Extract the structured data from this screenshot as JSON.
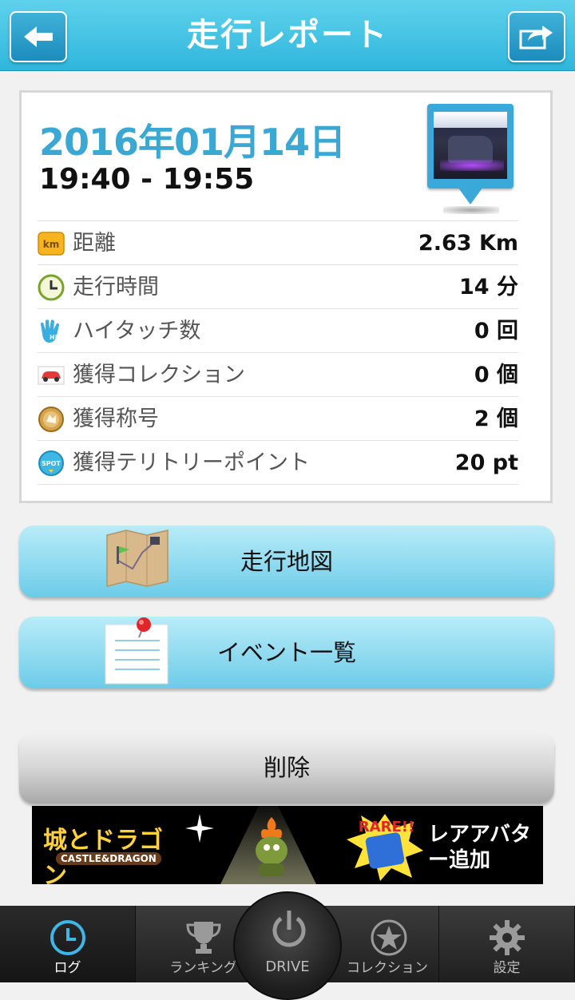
{
  "header": {
    "title": "走行レポート",
    "back_icon": "arrow-left-icon",
    "share_icon": "share-icon"
  },
  "report": {
    "date": "2016年01月14日",
    "time_range": "19:40 - 19:55",
    "stats": [
      {
        "icon": "km-icon",
        "label": "距離",
        "value": "2.63 Km"
      },
      {
        "icon": "clock-icon",
        "label": "走行時間",
        "value": "14 分"
      },
      {
        "icon": "high-five-icon",
        "label": "ハイタッチ数",
        "value": "0 回"
      },
      {
        "icon": "car-icon",
        "label": "獲得コレクション",
        "value": "0 個"
      },
      {
        "icon": "medal-icon",
        "label": "獲得称号",
        "value": "2 個"
      },
      {
        "icon": "spot-icon",
        "label": "獲得テリトリーポイント",
        "value": "20 pt"
      }
    ]
  },
  "buttons": {
    "map": "走行地図",
    "events": "イベント一覧",
    "delete": "削除"
  },
  "banner": {
    "game_title": "城とドラゴン",
    "game_subtitle": "CASTLE&DRAGON",
    "rare_badge": "RARE!!",
    "promo_text": "レアアバター追加"
  },
  "nav": {
    "items": [
      {
        "label": "ログ",
        "icon": "clock-icon"
      },
      {
        "label": "ランキング",
        "icon": "trophy-icon"
      },
      {
        "label": "DRIVE",
        "icon": "power-icon"
      },
      {
        "label": "コレクション",
        "icon": "star-icon"
      },
      {
        "label": "設定",
        "icon": "gear-icon"
      }
    ]
  },
  "colors": {
    "header": "#2fb6dc",
    "accent_date": "#3aa8d2",
    "button_blue": "#8fdaf0",
    "button_gray": "#d6d6d6"
  }
}
